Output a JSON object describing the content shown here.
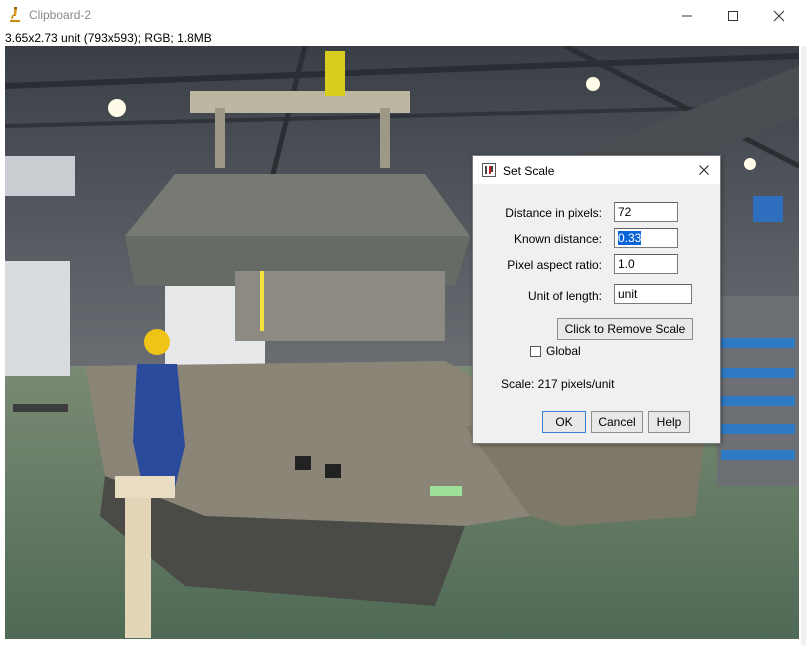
{
  "window": {
    "title": "Clipboard-2",
    "info": "3.65x2.73 unit (793x593); RGB; 1.8MB"
  },
  "dialog": {
    "title": "Set Scale",
    "distance_label": "Distance in pixels:",
    "distance_value": "72",
    "known_label": "Known distance:",
    "known_value": "0.33",
    "aspect_label": "Pixel aspect ratio:",
    "aspect_value": "1.0",
    "unit_label": "Unit of length:",
    "unit_value": "unit",
    "remove_scale_label": "Click to Remove Scale",
    "global_label": "Global",
    "global_checked": false,
    "scale_text": "Scale: 217 pixels/unit",
    "ok_label": "OK",
    "cancel_label": "Cancel",
    "help_label": "Help"
  },
  "icons": {
    "app": "microscope-icon",
    "dialog": "imagej-icon",
    "minimize": "minimize-icon",
    "maximize": "maximize-icon",
    "close": "close-icon"
  }
}
